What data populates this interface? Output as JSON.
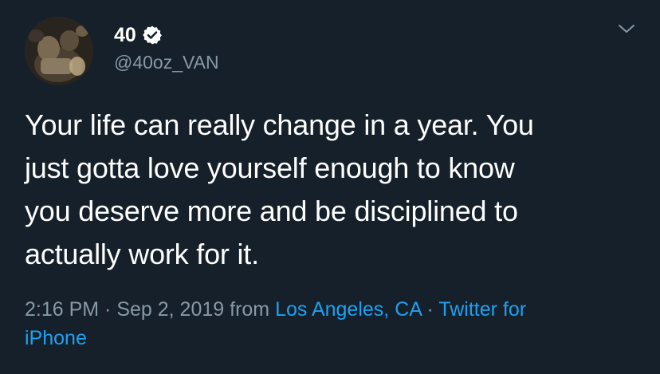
{
  "author": {
    "display_name": "40",
    "handle": "@40oz_VAN",
    "verified": true
  },
  "tweet": {
    "text_lines": [
      "Your life can really change in a year. You",
      "just gotta love yourself enough to know",
      "you deserve more and be disciplined to",
      "actually work for it."
    ]
  },
  "meta": {
    "time": "2:16 PM",
    "sep1": " · ",
    "date": "Sep 2, 2019",
    "from_word": " from ",
    "location": "Los Angeles, CA",
    "sep2": " · ",
    "source_line1": "Twitter for",
    "source_line2": "iPhone"
  },
  "icons": {
    "verified": "verified-badge-icon",
    "menu": "chevron-down-icon"
  },
  "colors": {
    "background": "#15202b",
    "text": "#ffffff",
    "secondary": "#8899a6",
    "link": "#1da1f2"
  }
}
